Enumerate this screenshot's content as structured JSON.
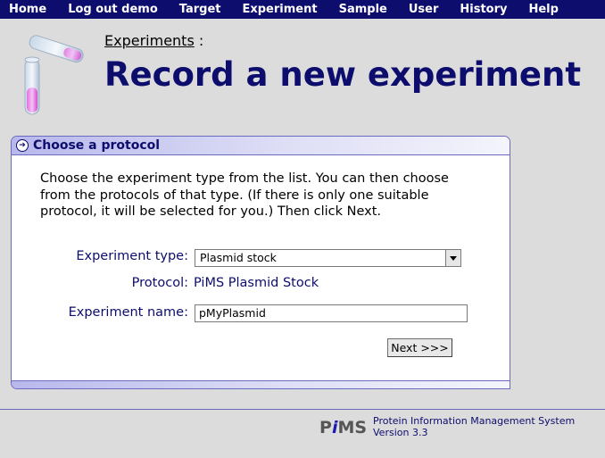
{
  "nav": {
    "items": [
      {
        "label": "Home"
      },
      {
        "label": "Log out demo"
      },
      {
        "label": "Target"
      },
      {
        "label": "Experiment"
      },
      {
        "label": "Sample"
      },
      {
        "label": "User"
      },
      {
        "label": "History"
      },
      {
        "label": "Help"
      }
    ]
  },
  "header": {
    "breadcrumb_link": "Experiments",
    "breadcrumb_sep": ":",
    "title": "Record a new experiment"
  },
  "panel": {
    "title": "Choose a protocol",
    "intro": "Choose the experiment type from the list. You can then choose from the protocols of that type. (If there is only one suitable protocol, it will be selected for you.) Then click Next.",
    "experiment_type_label": "Experiment type:",
    "experiment_type_value": "Plasmid stock",
    "protocol_label": "Protocol:",
    "protocol_value": "PiMS Plasmid Stock",
    "experiment_name_label": "Experiment name:",
    "experiment_name_value": "pMyPlasmid",
    "next_label": "Next >>>"
  },
  "footer": {
    "logo_text_p": "P",
    "logo_text_i": "i",
    "logo_text_ms": "MS",
    "line1": "Protein Information Management System",
    "line2": "Version 3.3"
  },
  "colors": {
    "nav_bg": "#0d0d6e",
    "title": "#0d0d6e",
    "page_bg": "#dcdcdc",
    "accent": "#6a6ac0"
  }
}
